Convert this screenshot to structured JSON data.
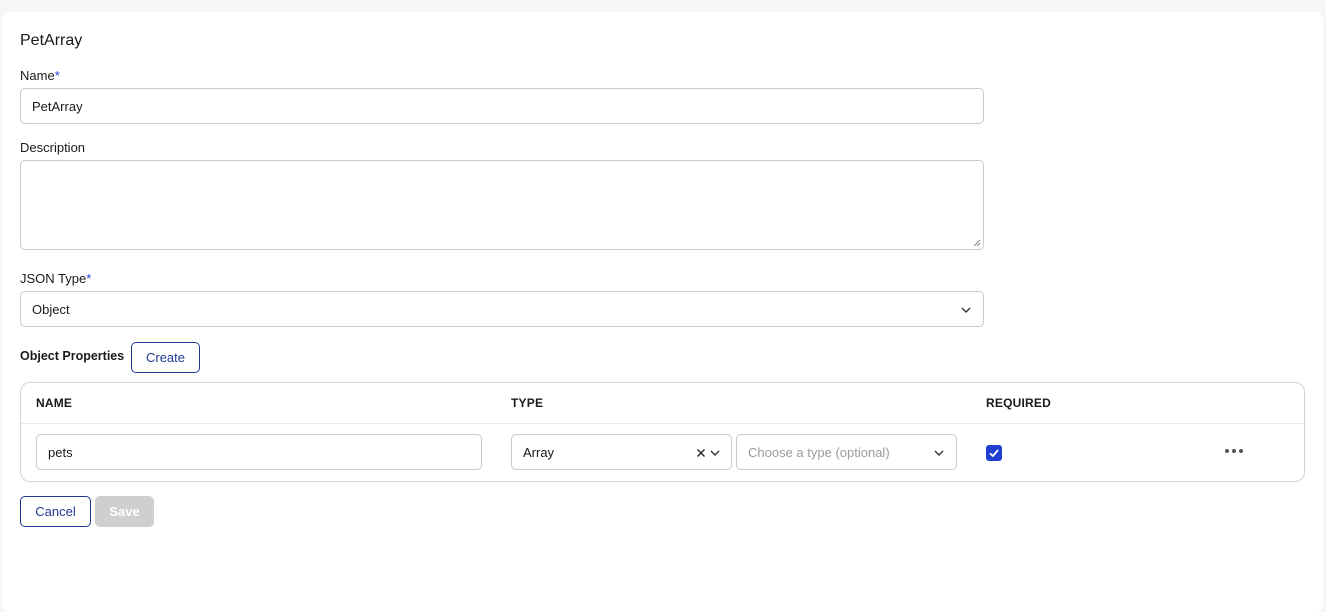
{
  "form": {
    "title": "PetArray",
    "name_label": "Name",
    "required_mark": "*",
    "name_value": "PetArray",
    "description_label": "Description",
    "description_value": "",
    "json_type_label": "JSON Type",
    "json_type_value": "Object",
    "object_properties_label": "Object Properties",
    "create_label": "Create"
  },
  "table": {
    "headers": [
      "NAME",
      "TYPE",
      "REQUIRED"
    ],
    "rows": [
      {
        "name": "pets",
        "type": "Array",
        "subtype_placeholder": "Choose a type (optional)",
        "required": true
      }
    ]
  },
  "actions": {
    "cancel_label": "Cancel",
    "save_label": "Save"
  },
  "colors": {
    "accent": "#1f3fd1",
    "button_border": "#1f3a93",
    "disabled": "#cfcfcf"
  },
  "icons": {
    "dropdown": "chevron-down-icon",
    "clear": "close-icon",
    "more": "more-horizontal-icon",
    "check": "checkmark-icon"
  }
}
